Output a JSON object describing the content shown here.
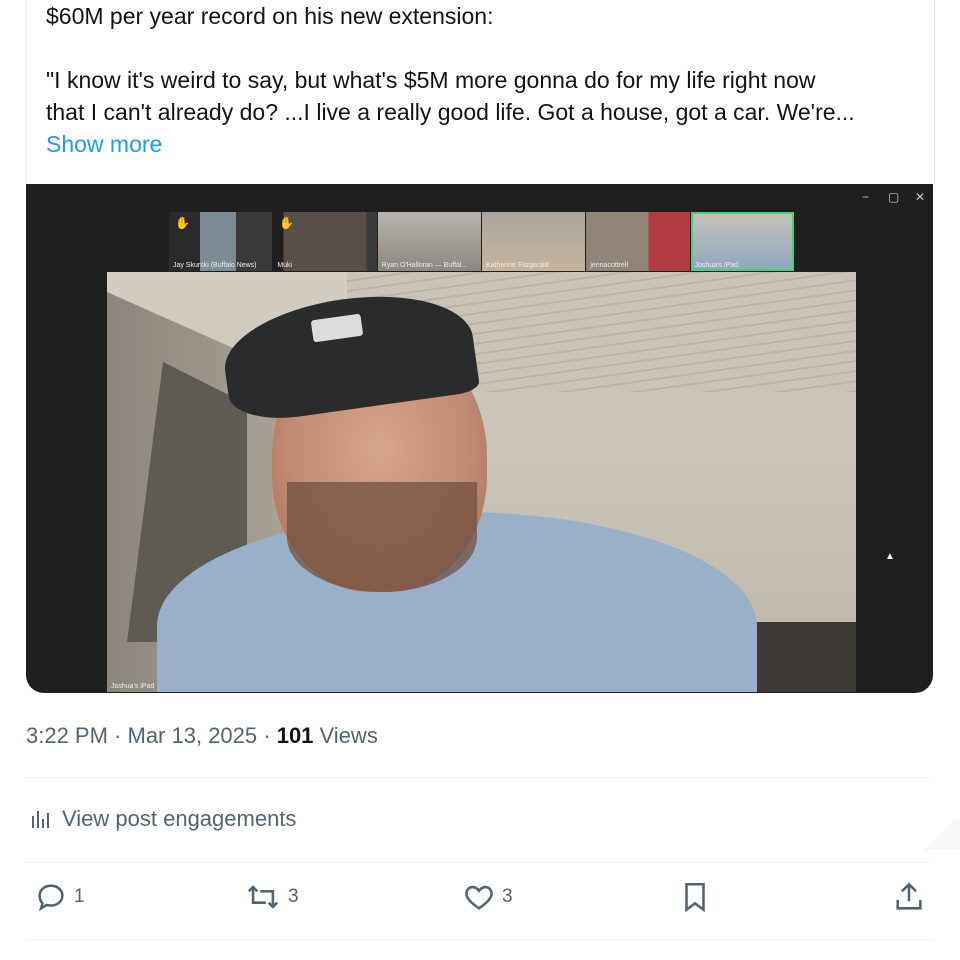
{
  "post": {
    "text_lines": [
      "$60M per year record on his new extension:",
      "\"I know it's weird to say, but what's $5M more gonna do for my life right now",
      "that I can't already do? ...I live a really good life. Got a house, got a car. We're..."
    ],
    "show_more": "Show more"
  },
  "video": {
    "participants": [
      "Jay Skurski (Buffalo News)",
      "Muki",
      "Ryan O'Halloran — Buffal...",
      "Katherine Fitzgerald",
      "jennacottrell",
      "Joshua's iPad"
    ],
    "main_label": "Joshua's iPad",
    "window_controls": [
      "−",
      "▢",
      "✕"
    ]
  },
  "meta": {
    "time": "3:22 PM",
    "sep1": " · ",
    "date": "Mar 13, 2025",
    "sep2": " · ",
    "views_count": "101",
    "views_label": " Views"
  },
  "engagements": {
    "label": "View post engagements",
    "icon": "analytics-icon"
  },
  "actions": {
    "reply": {
      "count": "1",
      "icon": "reply-icon"
    },
    "repost": {
      "count": "3",
      "icon": "repost-icon"
    },
    "like": {
      "count": "3",
      "icon": "heart-icon"
    },
    "bookmark": {
      "icon": "bookmark-icon"
    },
    "share": {
      "icon": "share-icon"
    }
  },
  "colors": {
    "link": "#1d9bf0",
    "muted": "#536471",
    "text": "#0f1419",
    "active_tile": "#43d17a"
  }
}
